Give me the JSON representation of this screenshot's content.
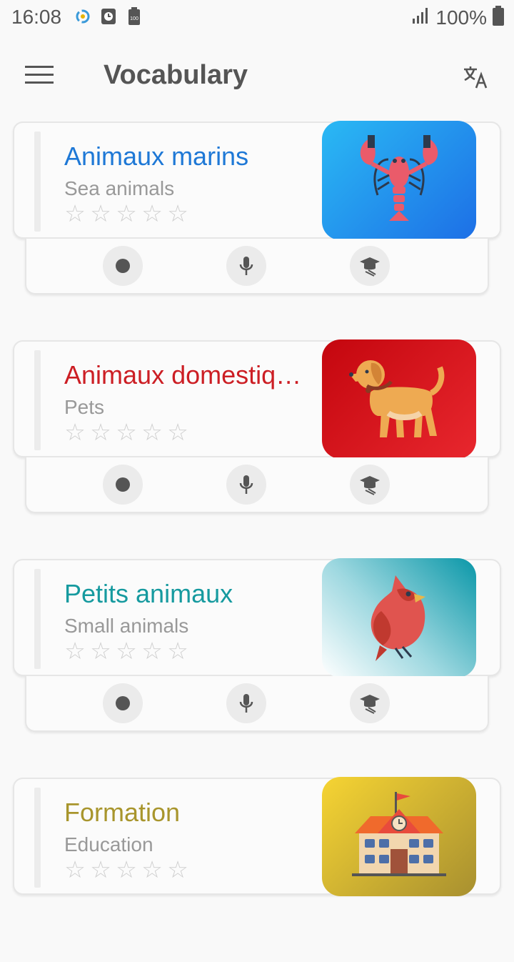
{
  "status_bar": {
    "time": "16:08",
    "battery_text": "100%",
    "icons": [
      "sync-icon",
      "clock-icon",
      "battery-saver-icon",
      "signal-icon",
      "battery-icon"
    ]
  },
  "app_bar": {
    "title": "Vocabulary",
    "menu_icon": "hamburger-menu-icon",
    "action_icon": "translate-icon"
  },
  "colors": {
    "sea": "#1e78d6",
    "pets": "#cc1e24",
    "small": "#169a9f",
    "education": "#a8952c"
  },
  "cards": [
    {
      "title": "Animaux marins",
      "subtitle": "Sea animals",
      "stars": 0,
      "image": "lobster-icon",
      "title_color": "#1e78d6"
    },
    {
      "title": "Animaux domestiques",
      "subtitle": "Pets",
      "stars": 0,
      "image": "dog-icon",
      "title_color": "#cc1e24"
    },
    {
      "title": "Petits animaux",
      "subtitle": "Small animals",
      "stars": 0,
      "image": "bird-icon",
      "title_color": "#169a9f"
    },
    {
      "title": "Formation",
      "subtitle": "Education",
      "stars": 0,
      "image": "school-icon",
      "title_color": "#a8952c"
    }
  ],
  "card_actions": [
    "record-icon",
    "microphone-icon",
    "graduation-cap-icon"
  ]
}
